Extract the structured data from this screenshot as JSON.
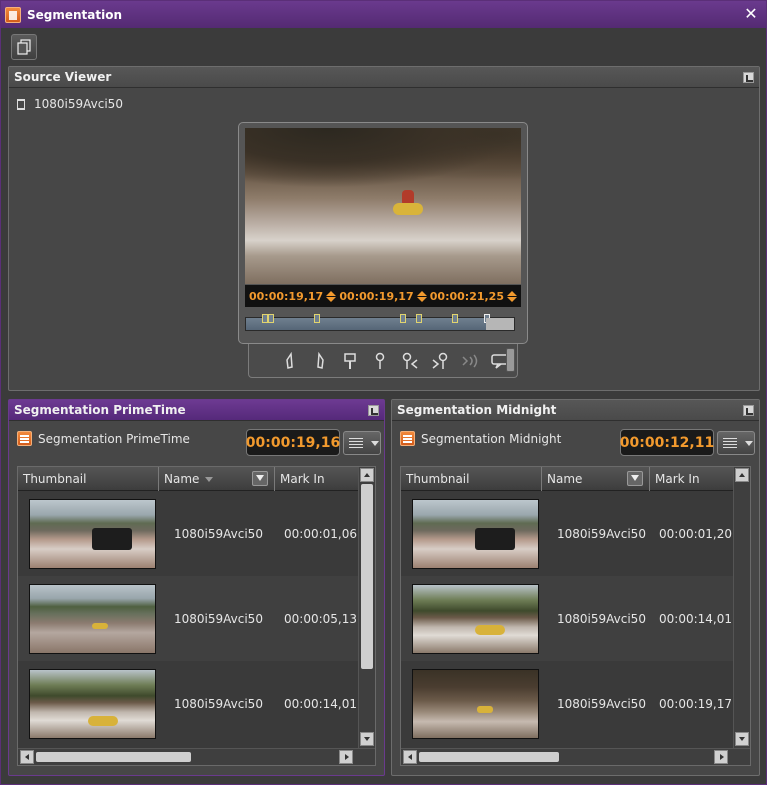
{
  "window": {
    "title": "Segmentation"
  },
  "source_viewer": {
    "title": "Source Viewer",
    "clip_name": "1080i59Avci50",
    "timecode_current": "00:00:19,17",
    "timecode_mark_in": "00:00:19,17",
    "timecode_duration": "00:00:21,25",
    "colors": {
      "timecode": "#f29a2e"
    }
  },
  "columns": {
    "thumbnail": "Thumbnail",
    "name": "Name",
    "mark_in": "Mark In"
  },
  "primetime": {
    "panel_title": "Segmentation PrimeTime",
    "label": "Segmentation PrimeTime",
    "timecode": "00:00:19,16",
    "rows": [
      {
        "name": "1080i59Avci50",
        "mark_in": "00:00:01,06"
      },
      {
        "name": "1080i59Avci50",
        "mark_in": "00:00:05,13"
      },
      {
        "name": "1080i59Avci50",
        "mark_in": "00:00:14,01"
      }
    ]
  },
  "midnight": {
    "panel_title": "Segmentation Midnight",
    "label": "Segmentation Midnight",
    "timecode": "00:00:12,11",
    "rows": [
      {
        "name": "1080i59Avci50",
        "mark_in": "00:00:01,20"
      },
      {
        "name": "1080i59Avci50",
        "mark_in": "00:00:14,01"
      },
      {
        "name": "1080i59Avci50",
        "mark_in": "00:00:19,17"
      }
    ]
  }
}
